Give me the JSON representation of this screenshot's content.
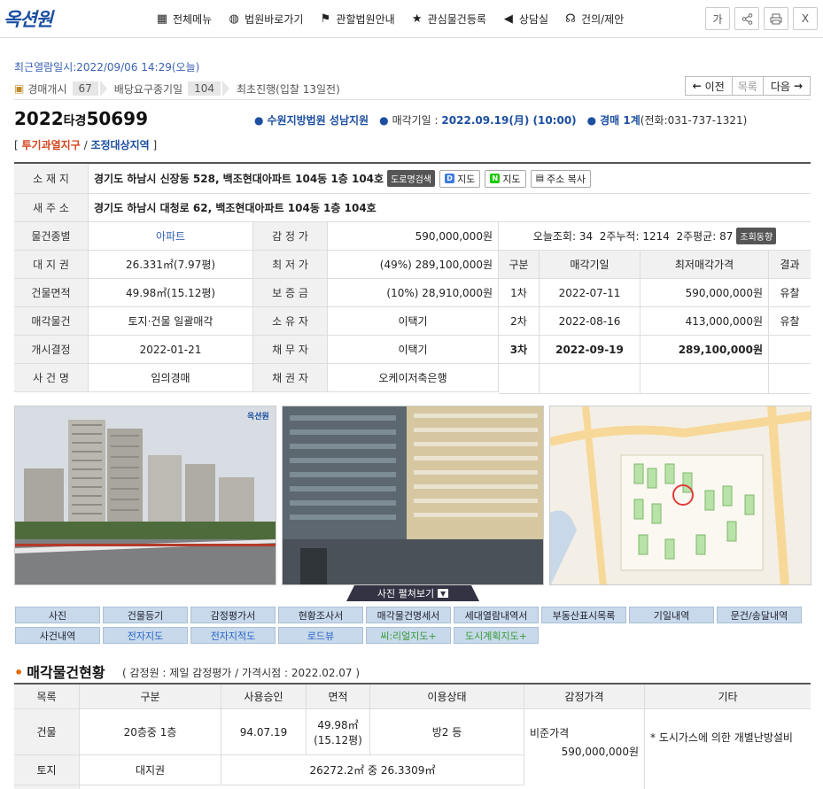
{
  "brand": {
    "logo": "옥션원"
  },
  "nav": [
    "전체메뉴",
    "법원바로가기",
    "관할법원안내",
    "관심물건등록",
    "상담실",
    "건의/제안"
  ],
  "tools": {
    "font": "가",
    "share": "share",
    "print": "print",
    "close": "X"
  },
  "recent_view": "최근열람일시:2022/09/06 14:29(오늘)",
  "steps": [
    {
      "label": "경매개시",
      "count": "67"
    },
    {
      "label": "배당요구종기일",
      "count": "104"
    }
  ],
  "step_final": "최초진행(입찰 13일전)",
  "pager": {
    "prev": "이전",
    "list": "목록",
    "next": "다음"
  },
  "case": {
    "year": "2022",
    "type": "타경",
    "number": "50699"
  },
  "court": {
    "name": "수원지방법원 성남지원",
    "sale_date_label": "매각기일 :",
    "sale_date": "2022.09.19(月) (10:00)",
    "dept": "경매 1계",
    "phone": "(전화:031-737-1321)"
  },
  "zones": {
    "open": "[",
    "zone1": "투기과열지구",
    "sep": "/",
    "zone2": "조정대상지역",
    "close": "]"
  },
  "info": {
    "location_label": "소 재 지",
    "location": "경기도 하남시 신장동 528, 백조현대아파트 104동 1층 104호",
    "road_search": "도로명검색",
    "map1": "지도",
    "map2": "지도",
    "copy": "주소 복사",
    "new_addr_label": "새 주 소",
    "new_addr": "경기도 하남시 대청로 62, 백조현대아파트 104동 1층 104호",
    "rows": [
      {
        "l1": "물건종별",
        "v1": "아파트",
        "l2": "감 정 가",
        "v2": "590,000,000원"
      },
      {
        "l1": "대 지 권",
        "v1": "26.331㎡(7.97평)",
        "l2": "최 저 가",
        "v2": "(49%) 289,100,000원"
      },
      {
        "l1": "건물면적",
        "v1": "49.98㎡(15.12평)",
        "l2": "보 증 금",
        "v2": "(10%) 28,910,000원"
      },
      {
        "l1": "매각물건",
        "v1": "토지·건물 일괄매각",
        "l2": "소 유 자",
        "v2": "이택기"
      },
      {
        "l1": "개시결정",
        "v1": "2022-01-21",
        "l2": "채 무 자",
        "v2": "이택기"
      },
      {
        "l1": "사 건 명",
        "v1": "임의경매",
        "l2": "채 권 자",
        "v2": "오케이저축은행"
      }
    ]
  },
  "views": {
    "text": "오늘조회: 34  2주누적: 1214  2주평균: 87",
    "button": "조회동향"
  },
  "schedule": {
    "headers": [
      "구분",
      "매각기일",
      "최저매각가격",
      "결과"
    ],
    "rows": [
      {
        "round": "1차",
        "date": "2022-07-11",
        "price": "590,000,000원",
        "result": "유찰"
      },
      {
        "round": "2차",
        "date": "2022-08-16",
        "price": "413,000,000원",
        "result": "유찰"
      },
      {
        "round": "3차",
        "date": "2022-09-19",
        "price": "289,100,000원",
        "result": ""
      }
    ]
  },
  "photo_toggle": "사진 펼쳐보기",
  "watermark": "옥션원",
  "buttons": [
    {
      "label": "사진",
      "style": ""
    },
    {
      "label": "건물등기",
      "style": ""
    },
    {
      "label": "감정평가서",
      "style": ""
    },
    {
      "label": "현황조사서",
      "style": ""
    },
    {
      "label": "매각물건명세서",
      "style": ""
    },
    {
      "label": "세대열람내역서",
      "style": ""
    },
    {
      "label": "부동산표시목록",
      "style": ""
    },
    {
      "label": "기일내역",
      "style": ""
    },
    {
      "label": "문건/송달내역",
      "style": ""
    },
    {
      "label": "사건내역",
      "style": ""
    },
    {
      "label": "전자지도",
      "style": "blue"
    },
    {
      "label": "전자지적도",
      "style": "blue"
    },
    {
      "label": "로드뷰",
      "style": "blue"
    },
    {
      "label": "씨:리얼지도+",
      "style": "green"
    },
    {
      "label": "도시계획지도+",
      "style": "green"
    }
  ],
  "section": {
    "title": "매각물건현황",
    "sub": "( 감정원 : 제일 감정평가 / 가격시점 : 2022.02.07 )"
  },
  "status_table": {
    "headers": [
      "목록",
      "구분",
      "사용승인",
      "면적",
      "이용상태",
      "감정가격",
      "기타"
    ],
    "building": {
      "item": "건물",
      "kind": "20층중 1층",
      "approval": "94.07.19",
      "area1": "49.98㎡",
      "area2": "(15.12평)",
      "use": "방2 등"
    },
    "land": {
      "item": "토지",
      "kind": "대지권",
      "area": "26272.2㎡ 중 26.3309㎡"
    },
    "price_label": "비준가격",
    "price": "590,000,000원",
    "note": "* 도시가스에 의한 개별난방설비"
  },
  "colors": {
    "accent": "#1c4fa0",
    "zone": "#d4461e",
    "bullet": "#e36c0a"
  }
}
